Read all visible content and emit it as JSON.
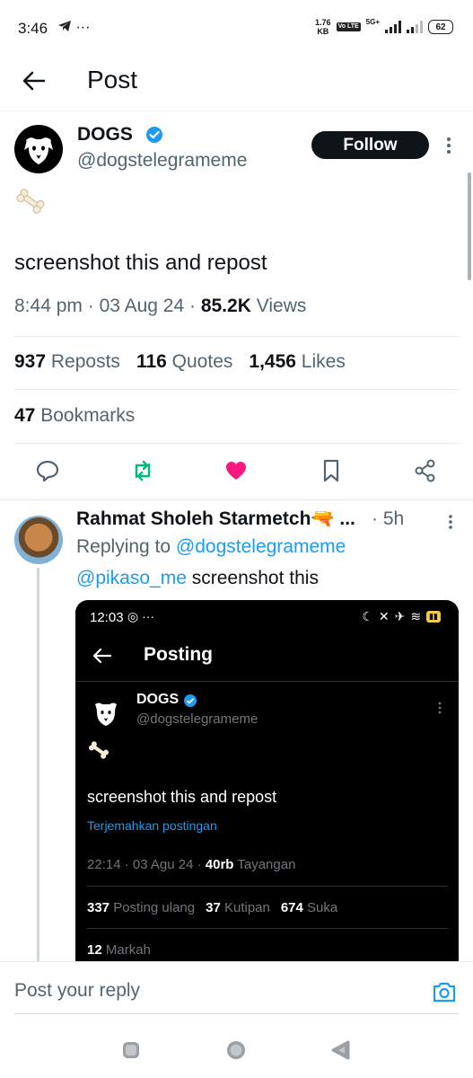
{
  "status_bar": {
    "time": "3:46",
    "speed_value": "1.76",
    "speed_unit": "KB",
    "volte": "Vo LTE",
    "network": "5G+",
    "battery": "62"
  },
  "header": {
    "title": "Post"
  },
  "post": {
    "author_name": "DOGS",
    "author_handle": "@dogstelegrameme",
    "follow_label": "Follow",
    "text": "screenshot this and repost",
    "time": "8:44 pm",
    "date": "03 Aug 24",
    "views_count": "85.2K",
    "views_label": "Views",
    "reposts_count": "937",
    "reposts_label": "Reposts",
    "quotes_count": "116",
    "quotes_label": "Quotes",
    "likes_count": "1,456",
    "likes_label": "Likes",
    "bookmarks_count": "47",
    "bookmarks_label": "Bookmarks",
    "liked": true
  },
  "reply": {
    "author_name": "Rahmat Sholeh Starmetch🔫 ...",
    "time": "· 5h",
    "replying_prefix": "Replying to",
    "replying_handle": "@dogstelegrameme",
    "mention": "@pikaso_me",
    "text": "screenshot this",
    "embedded_screenshot": {
      "time": "12:03",
      "title": "Posting",
      "author_name": "DOGS",
      "author_handle": "@dogstelegrameme",
      "text": "screenshot this and repost",
      "translate": "Terjemahkan postingan",
      "time_date": "22:14 · 03 Agu 24 ·",
      "views_count": "40rb",
      "views_label": "Tayangan",
      "reposts_count": "337",
      "reposts_label": "Posting ulang",
      "quotes_count": "37",
      "quotes_label": "Kutipan",
      "likes_count": "674",
      "likes_label": "Suka",
      "bookmarks_count": "12",
      "bookmarks_label": "Markah"
    }
  },
  "reply_bar": {
    "placeholder": "Post your reply"
  },
  "colors": {
    "accent": "#1d9bf0",
    "like": "#f91880",
    "repost": "#00ba7c",
    "text_primary": "#0f1419",
    "text_secondary": "#536471"
  }
}
